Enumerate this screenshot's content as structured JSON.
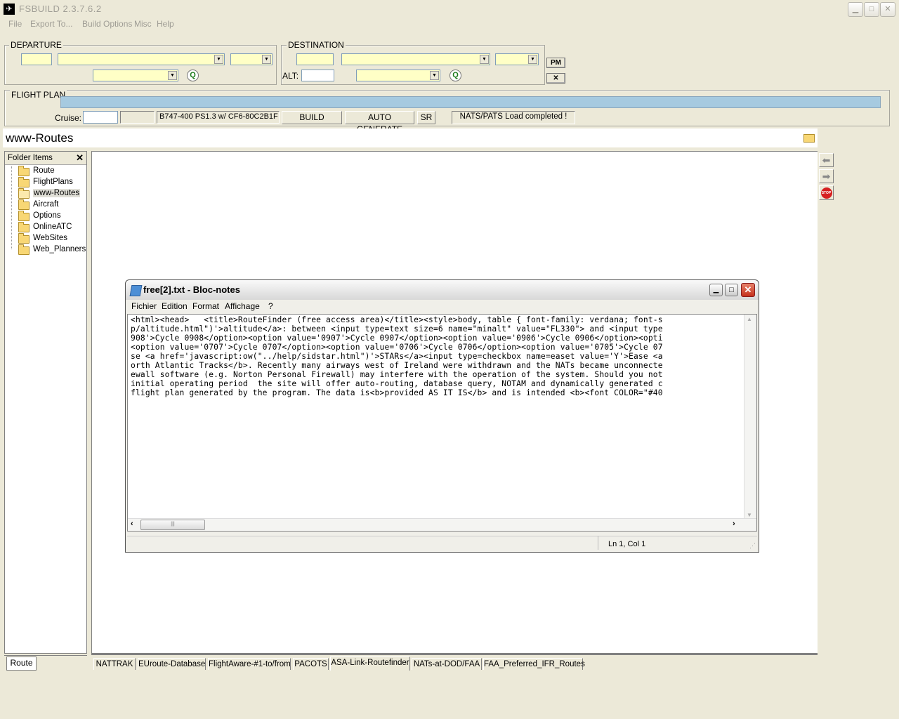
{
  "app": {
    "title": "FSBUILD 2.3.7.6.2",
    "menu": [
      "File",
      "Export To...",
      "Build Options",
      "Misc",
      "Help"
    ]
  },
  "departure": {
    "label": "DEPARTURE"
  },
  "destination": {
    "label": "DESTINATION",
    "alt_label": "ALT:",
    "pm_label": "PM"
  },
  "flight_plan": {
    "label": "FLIGHT PLAN",
    "cruise_label": "Cruise:",
    "aircraft": "B747-400 PS1.3 w/ CF6-80C2B1F",
    "build_label": "BUILD",
    "auto_generate_label": "AUTO GENERATE",
    "sr_label": "SR",
    "status": "NATS/PATS Load completed !"
  },
  "panel": {
    "title": "www-Routes"
  },
  "folder_panel": {
    "header": "Folder Items",
    "items": [
      "Route",
      "FlightPlans",
      "www-Routes",
      "Aircraft",
      "Options",
      "OnlineATC",
      "WebSites",
      "Web_Planners"
    ],
    "selected": "www-Routes",
    "bottom_tab": "Route"
  },
  "tabs": [
    "NATTRAK",
    "EUroute-Database",
    "FlightAware-#1-to/from",
    "PACOTS",
    "ASA-Link-Routefinder",
    "NATs-at-DOD/FAA",
    "FAA_Preferred_IFR_Routes"
  ],
  "active_tab": "ASA-Link-Routefinder",
  "notepad": {
    "title": "free[2].txt - Bloc-notes",
    "menu": [
      "Fichier",
      "Edition",
      "Format",
      "Affichage",
      "?"
    ],
    "lines": [
      "<html><head>   <title>RouteFinder (free access area)</title><style>body, table { font-family: verdana; font-s",
      "p/altitude.html\")'>altitude</a>: between <input type=text size=6 name=\"minalt\" value=\"FL330\"> and <input type",
      "908'>Cycle 0908</option><option value='0907'>Cycle 0907</option><option value='0906'>Cycle 0906</option><opti",
      "<option value='0707'>Cycle 0707</option><option value='0706'>Cycle 0706</option><option value='0705'>Cycle 07",
      "se <a href='javascript:ow(\"../help/sidstar.html\")'>STARs</a><input type=checkbox name=easet value='Y'>Ease <a",
      "orth Atlantic Tracks</b>. Recently many airways west of Ireland were withdrawn and the NATs became unconnecte",
      "ewall software (e.g. Norton Personal Firewall) may interfere with the operation of the system. Should you not",
      "initial operating period  the site will offer auto-routing, database query, NOTAM and dynamically generated c",
      "flight plan generated by the program. The data is<b>provided AS IT IS</b> and is intended <b><font COLOR=\"#40"
    ],
    "status": "Ln 1, Col 1"
  }
}
